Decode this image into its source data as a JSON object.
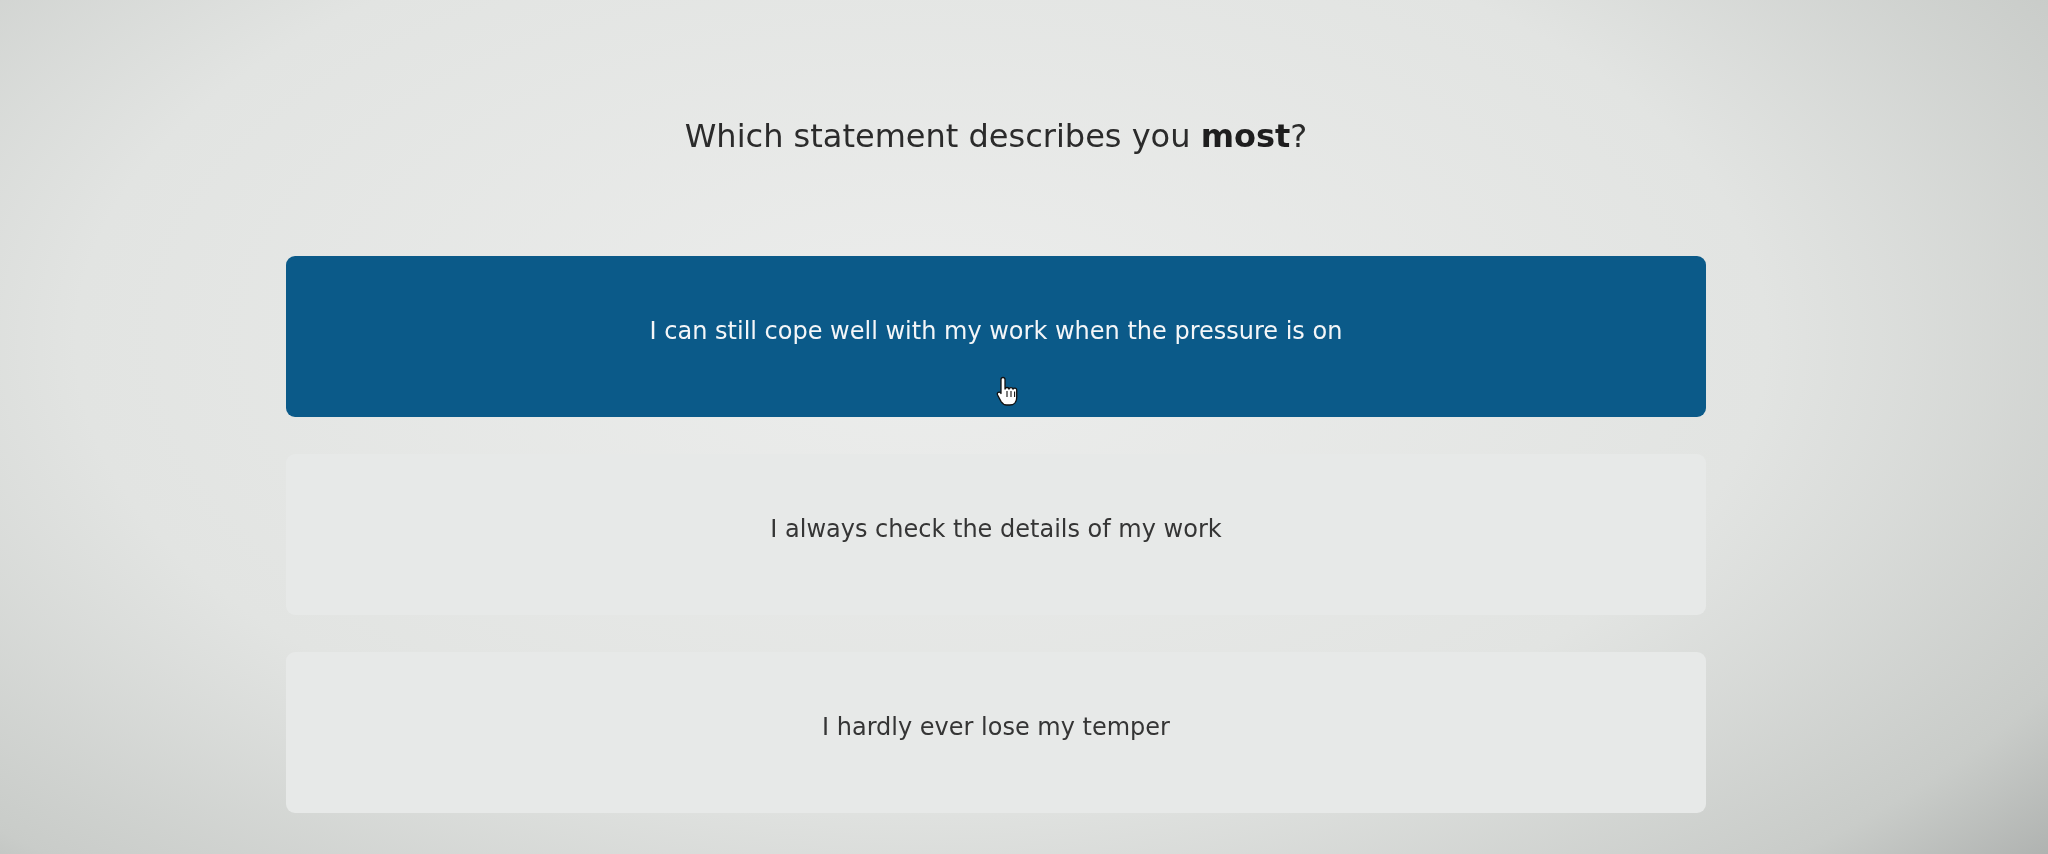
{
  "question": {
    "text": "Which statement describes you **most**?"
  },
  "options": [
    {
      "label": "I can still cope well with my work when the pressure is on",
      "selected": true
    },
    {
      "label": "I always check the details of my work",
      "selected": false
    },
    {
      "label": "I hardly ever lose my temper",
      "selected": false
    }
  ]
}
